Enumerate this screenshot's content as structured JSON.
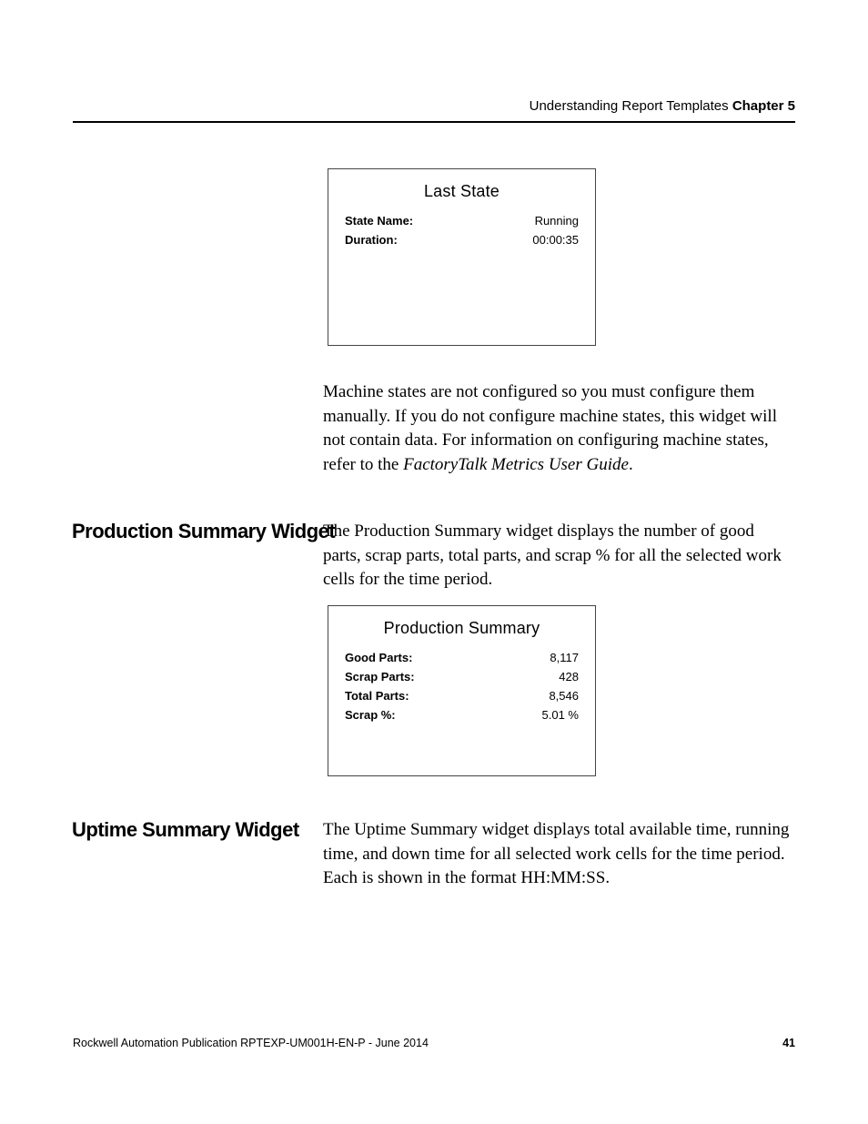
{
  "header": {
    "breadcrumb_plain": "Understanding Report Templates ",
    "breadcrumb_bold": "Chapter 5"
  },
  "lastState": {
    "title": "Last State",
    "rows": [
      {
        "label": "State Name:",
        "value": "Running"
      },
      {
        "label": "Duration:",
        "value": "00:00:35"
      }
    ]
  },
  "para1_a": "Machine states are not configured so you must configure them manually. If you do not configure machine states, this widget will not contain data. For information on configuring machine states, refer to the ",
  "para1_i": "FactoryTalk Metrics User Guide",
  "para1_b": ".",
  "sideHeadings": {
    "prod": "Production Summary Widget",
    "uptime": "Uptime Summary Widget"
  },
  "para2": "The Production Summary widget displays the number of good parts, scrap parts, total parts, and scrap % for all the selected work cells for the time period.",
  "prodSummary": {
    "title": "Production Summary",
    "rows": [
      {
        "label": "Good Parts:",
        "value": "8,117"
      },
      {
        "label": "Scrap Parts:",
        "value": "428"
      },
      {
        "label": "Total Parts:",
        "value": "8,546"
      },
      {
        "label": "Scrap %:",
        "value": "5.01 %"
      }
    ]
  },
  "para3": "The Uptime Summary widget displays total available time, running time, and down time for all selected work cells for the time period. Each is shown in the format HH:MM:SS.",
  "footer": {
    "pub": "Rockwell Automation Publication RPTEXP-UM001H-EN-P - June 2014",
    "page": "41"
  }
}
